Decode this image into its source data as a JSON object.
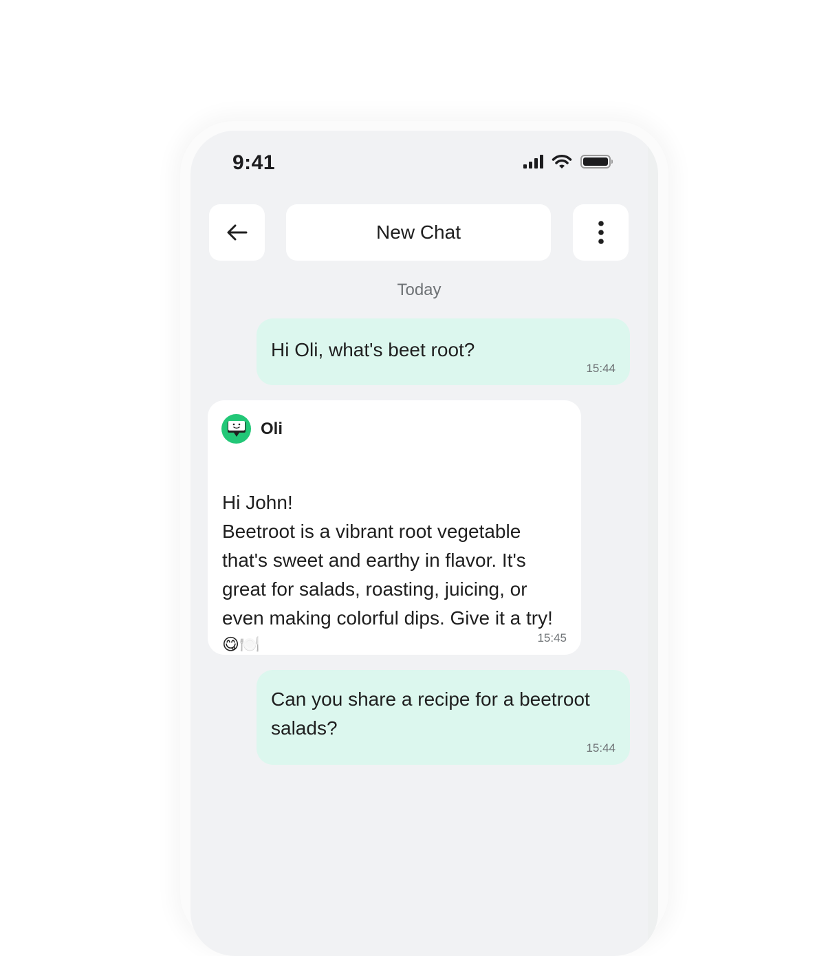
{
  "status_bar": {
    "time": "9:41",
    "icons": [
      "cellular-signal-icon",
      "wifi-icon",
      "battery-icon"
    ]
  },
  "header": {
    "back_icon": "arrow-left-icon",
    "title": "New Chat",
    "menu_icon": "more-vertical-icon"
  },
  "chat": {
    "date_separator": "Today",
    "messages": [
      {
        "direction": "outgoing",
        "text": "Hi Oli, what's beet root?",
        "time": "15:44"
      },
      {
        "direction": "incoming",
        "sender": "Oli",
        "avatar_icon": "chat-bot-icon",
        "text": "Hi John!\nBeetroot is a vibrant root vegetable that's sweet and earthy in flavor. It's great for salads, roasting, juicing, or even making colorful dips. Give it a try!",
        "emoji": "😋🍽️",
        "time": "15:45"
      },
      {
        "direction": "outgoing",
        "text": "Can you share a recipe for a beetroot salads?",
        "time": "15:44"
      }
    ]
  },
  "colors": {
    "background": "#f1f2f4",
    "outgoing_bubble": "#dcf7ee",
    "incoming_bubble": "#ffffff",
    "avatar_accent": "#22c777",
    "secondary_text": "#6e7275"
  }
}
